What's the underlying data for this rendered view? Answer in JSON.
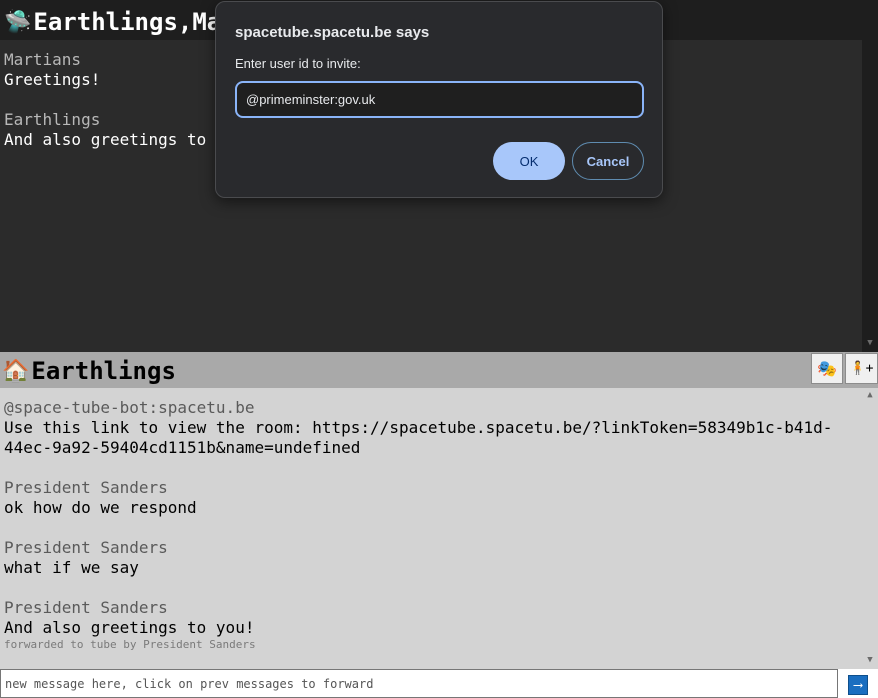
{
  "tube": {
    "icon": "flying-saucer-icon",
    "icon_glyph": "🛸",
    "title": "Earthlings,Ma",
    "messages": [
      {
        "sender": "Martians",
        "text": "Greetings!"
      },
      {
        "sender": "Earthlings",
        "text": "And also greetings to "
      }
    ]
  },
  "room": {
    "icon": "house-icon",
    "icon_glyph": "🏠",
    "title": "Earthlings",
    "buttons": {
      "masks_glyph": "🎭",
      "masks_icon": "theater-masks-icon",
      "invite_glyph": "🧍+",
      "invite_icon": "invite-person-icon"
    },
    "messages": [
      {
        "sender": "@space-tube-bot:spacetu.be",
        "text": "Use this link to view the room: https://spacetube.spacetu.be/?linkToken=58349b1c-b41d-44ec-9a92-59404cd1151b&name=undefined",
        "note": ""
      },
      {
        "sender": "President Sanders",
        "text": "ok how do we respond",
        "note": ""
      },
      {
        "sender": "President Sanders",
        "text": "what if we say",
        "note": ""
      },
      {
        "sender": "President Sanders",
        "text": "And also greetings to you!",
        "note": "forwarded to tube by President Sanders"
      }
    ]
  },
  "composer": {
    "placeholder": "new message here, click on prev messages to forward",
    "send_glyph": "⟶",
    "send_icon": "send-arrow-icon"
  },
  "dialog": {
    "title": "spacetube.spacetu.be says",
    "message": "Enter user id to invite:",
    "input_value": "@primeminster:gov.uk",
    "ok_label": "OK",
    "cancel_label": "Cancel"
  },
  "colors": {
    "top_bg": "#2b2b2b",
    "bottom_bg": "#d3d3d3",
    "dialog_bg": "#292a2d",
    "ok_button": "#a8c7fa",
    "send_button": "#1a6ec0"
  }
}
